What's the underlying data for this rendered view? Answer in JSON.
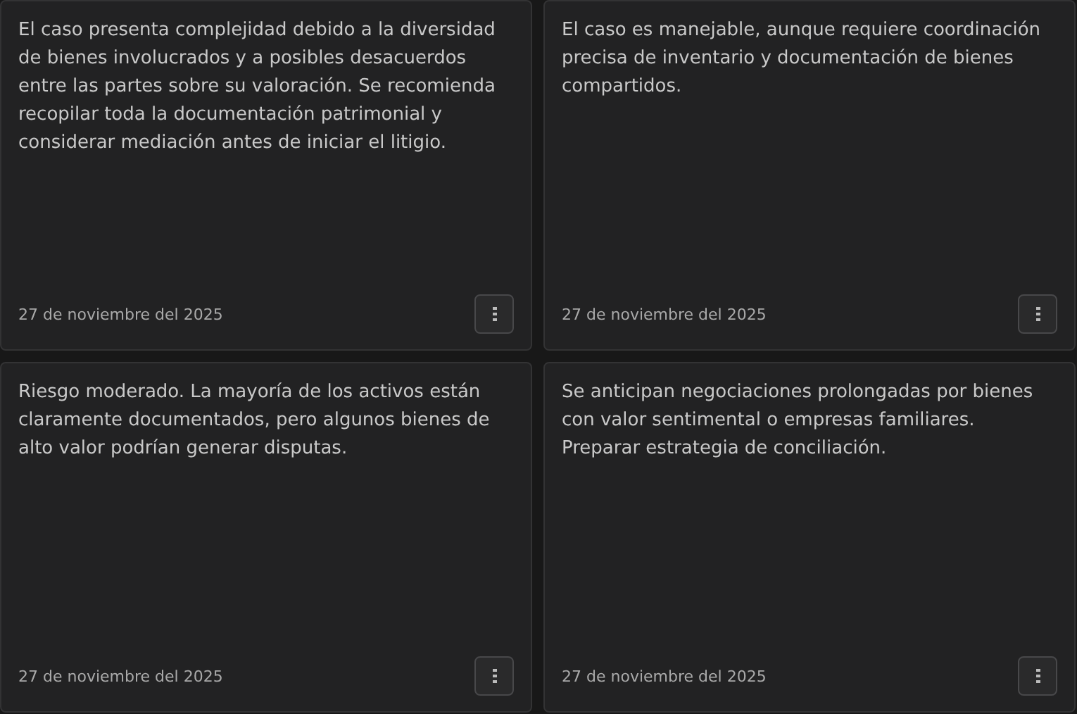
{
  "cards": [
    {
      "text": "El caso presenta complejidad debido a la diversidad de bienes involucrados y a posibles desacuerdos entre las partes sobre su valoración. Se recomienda recopilar toda la documentación patrimonial y considerar mediación antes de iniciar el litigio.",
      "date": "27 de noviembre del 2025"
    },
    {
      "text": "El caso es manejable, aunque requiere coordinación precisa de inventario y documentación de bienes compartidos.",
      "date": "27 de noviembre del 2025"
    },
    {
      "text": "Riesgo moderado. La mayoría de los activos están claramente documentados, pero algunos bienes de alto valor podrían generar disputas.",
      "date": "27 de noviembre del 2025"
    },
    {
      "text": "Se anticipan negociaciones prolongadas por bienes con valor sentimental o empresas familiares. Preparar estrategia de conciliación.",
      "date": "27 de noviembre del 2025"
    }
  ]
}
